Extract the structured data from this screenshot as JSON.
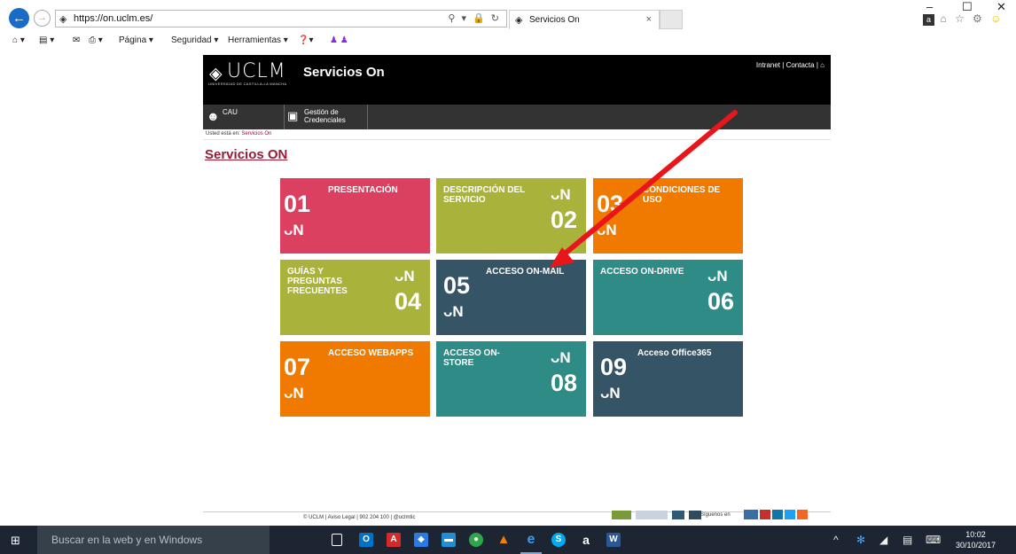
{
  "browser": {
    "url": "https://on.uclm.es/",
    "address_tools": "⚲ ▾ 🔒 ↻",
    "tab_title": "Servicios On",
    "tab_close": "×",
    "window_controls": [
      "–",
      "☐",
      "✕"
    ],
    "toolbar": [
      {
        "icon": "home-icon",
        "label": "⌂ ▾"
      },
      {
        "icon": "feeds-icon",
        "label": "▤ ▾"
      },
      {
        "icon": "mail-icon",
        "label": "✉"
      },
      {
        "icon": "print-icon",
        "label": "⎙ ▾"
      },
      {
        "icon": "",
        "label": "Página ▾"
      },
      {
        "icon": "",
        "label": "Seguridad ▾"
      },
      {
        "icon": "",
        "label": "Herramientas ▾"
      },
      {
        "icon": "help-icon",
        "label": "❓▾"
      }
    ]
  },
  "site": {
    "logo": "UCLM",
    "logo_sub": "UNIVERSIDAD DE CASTILLA-LA MANCHA",
    "title": "Servicios On",
    "top_links": {
      "intranet": "Intranet",
      "sep": "|",
      "contacta": "Contacta",
      "sep2": "|",
      "home": "⌂"
    },
    "subnav": [
      {
        "label": "CAU"
      },
      {
        "label_line1": "Gestión de",
        "label_line2": "Credenciales"
      }
    ],
    "breadcrumb": {
      "prefix": "Usted está en:",
      "link": "Servicios On"
    },
    "page_title": "Servicios ON"
  },
  "tiles": [
    {
      "num": "01",
      "title": "PRESENTACIÓN",
      "color": "#dc4060"
    },
    {
      "num": "02",
      "title_line1": "DESCRIPCIÓN DEL",
      "title_line2": "SERVICIO",
      "color": "#a9b23b"
    },
    {
      "num": "03",
      "title_line1": "CONDICIONES DE",
      "title_line2": "USO",
      "color": "#f07a00"
    },
    {
      "num": "04",
      "title_line1": "GUÍAS Y",
      "title_line2": "PREGUNTAS",
      "title_line3": "FRECUENTES",
      "color": "#a9b23b"
    },
    {
      "num": "05",
      "title": "ACCESO ON-MAIL",
      "color": "#355466"
    },
    {
      "num": "06",
      "title": "ACCESO ON-DRIVE",
      "color": "#2f8b86"
    },
    {
      "num": "07",
      "title": "ACCESO WEBAPPS",
      "color": "#f07a00"
    },
    {
      "num": "08",
      "title_line1": "ACCESO ON-",
      "title_line2": "STORE",
      "color": "#2f8b86"
    },
    {
      "num": "09",
      "title": "Acceso Office365",
      "color": "#355466"
    }
  ],
  "on_mark": "ᴗN",
  "footer": {
    "text": "© UCLM | Aviso Legal | 902 204 100 | @uclmtic",
    "follow": "Síguenos en",
    "social": [
      "tuenti",
      "youtube",
      "linkedin",
      "twitter",
      "rss"
    ]
  },
  "annotation": {
    "color": "#e8161b"
  },
  "taskbar": {
    "search_placeholder": "Buscar en la web y en Windows",
    "time": "10:02",
    "date": "30/10/2017"
  }
}
